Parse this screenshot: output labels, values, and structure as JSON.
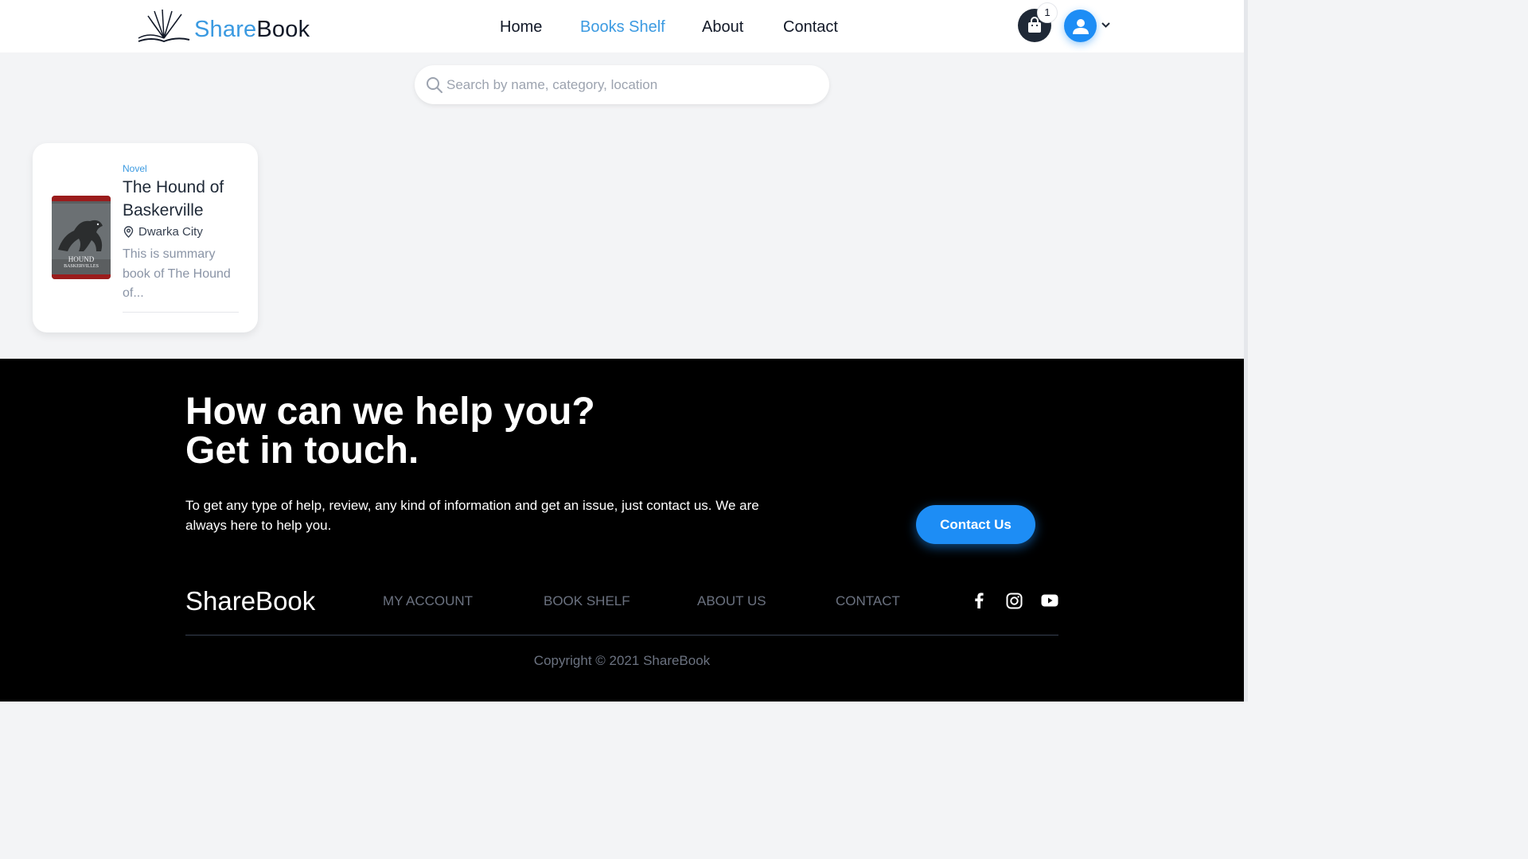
{
  "header": {
    "logo": {
      "share": "Share",
      "book": "Book"
    },
    "nav": [
      {
        "label": "Home"
      },
      {
        "label": "Books Shelf"
      },
      {
        "label": "About"
      },
      {
        "label": "Contact"
      }
    ],
    "active_nav": "Books Shelf",
    "cart_count": "1"
  },
  "search": {
    "placeholder": "Search by name, category, location",
    "value": ""
  },
  "books": [
    {
      "category": "Novel",
      "title": "The Hound of Baskerville",
      "location": "Dwarka City",
      "summary": "This is summary book of The Hound of...",
      "cover": {
        "title": "HOUND",
        "subtitle": "BASKERVILLES",
        "author": "ARTHUR CONAN DOYLE"
      }
    }
  ],
  "footer": {
    "headline_line1": "How can we help you?",
    "headline_line2": "Get in touch.",
    "help_text": "To get any type of help, review, any kind of information and get an issue, just contact us. We are always here to help you.",
    "contact_button": "Contact Us",
    "brand": "ShareBook",
    "links": [
      {
        "label": "MY ACCOUNT"
      },
      {
        "label": "BOOK SHELF"
      },
      {
        "label": "ABOUT US"
      },
      {
        "label": "CONTACT"
      }
    ],
    "social": [
      {
        "icon": "facebook-icon"
      },
      {
        "icon": "instagram-icon"
      },
      {
        "icon": "youtube-icon"
      }
    ],
    "copyright": "Copyright © 2021 ShareBook"
  },
  "colors": {
    "accent": "#3b9ae1",
    "button": "#1d8df5",
    "footer_bg": "#000000",
    "page_bg": "#f3f4f6"
  }
}
